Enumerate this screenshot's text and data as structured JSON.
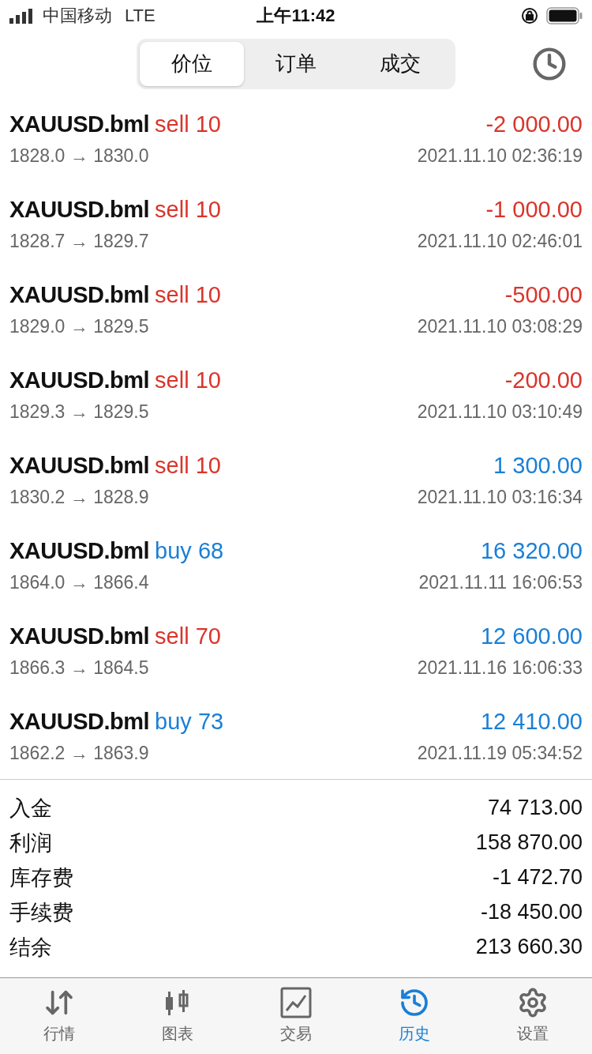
{
  "status_bar": {
    "carrier": "中国移动",
    "network": "LTE",
    "time": "上午11:42"
  },
  "segments": [
    {
      "label": "价位",
      "selected": true
    },
    {
      "label": "订单",
      "selected": false
    },
    {
      "label": "成交",
      "selected": false
    }
  ],
  "deals": [
    {
      "symbol": "XAUUSD.bml",
      "kind": "sell",
      "action": "sell 10",
      "prices": "1828.0 → 1830.0",
      "time": "2021.11.10 02:36:19",
      "profit": "-2 000.00",
      "color": "#d9352b"
    },
    {
      "symbol": "XAUUSD.bml",
      "kind": "sell",
      "action": "sell 10",
      "prices": "1828.7 → 1829.7",
      "time": "2021.11.10 02:46:01",
      "profit": "-1 000.00",
      "color": "#d9352b"
    },
    {
      "symbol": "XAUUSD.bml",
      "kind": "sell",
      "action": "sell 10",
      "prices": "1829.0 → 1829.5",
      "time": "2021.11.10 03:08:29",
      "profit": "-500.00",
      "color": "#d9352b"
    },
    {
      "symbol": "XAUUSD.bml",
      "kind": "sell",
      "action": "sell 10",
      "prices": "1829.3 → 1829.5",
      "time": "2021.11.10 03:10:49",
      "profit": "-200.00",
      "color": "#d9352b"
    },
    {
      "symbol": "XAUUSD.bml",
      "kind": "sell",
      "action": "sell 10",
      "prices": "1830.2 → 1828.9",
      "time": "2021.11.10 03:16:34",
      "profit": "1 300.00",
      "color": "#1a7fd6"
    },
    {
      "symbol": "XAUUSD.bml",
      "kind": "buy",
      "action": "buy 68",
      "prices": "1864.0 → 1866.4",
      "time": "2021.11.11 16:06:53",
      "profit": "16 320.00",
      "color": "#1a7fd6"
    },
    {
      "symbol": "XAUUSD.bml",
      "kind": "sell",
      "action": "sell 70",
      "prices": "1866.3 → 1864.5",
      "time": "2021.11.16 16:06:33",
      "profit": "12 600.00",
      "color": "#1a7fd6"
    },
    {
      "symbol": "XAUUSD.bml",
      "kind": "buy",
      "action": "buy 73",
      "prices": "1862.2 → 1863.9",
      "time": "2021.11.19 05:34:52",
      "profit": "12 410.00",
      "color": "#1a7fd6"
    }
  ],
  "summary": [
    {
      "label": "入金",
      "value": "74 713.00"
    },
    {
      "label": "利润",
      "value": "158 870.00"
    },
    {
      "label": "库存费",
      "value": "-1 472.70"
    },
    {
      "label": "手续费",
      "value": "-18 450.00"
    },
    {
      "label": "结余",
      "value": "213 660.30"
    }
  ],
  "tab_bar": [
    {
      "label": "行情",
      "kind": "quotes",
      "selected": false
    },
    {
      "label": "图表",
      "kind": "chart",
      "selected": false
    },
    {
      "label": "交易",
      "kind": "trade",
      "selected": false
    },
    {
      "label": "历史",
      "kind": "history",
      "selected": true
    },
    {
      "label": "设置",
      "kind": "settings",
      "selected": false
    }
  ]
}
